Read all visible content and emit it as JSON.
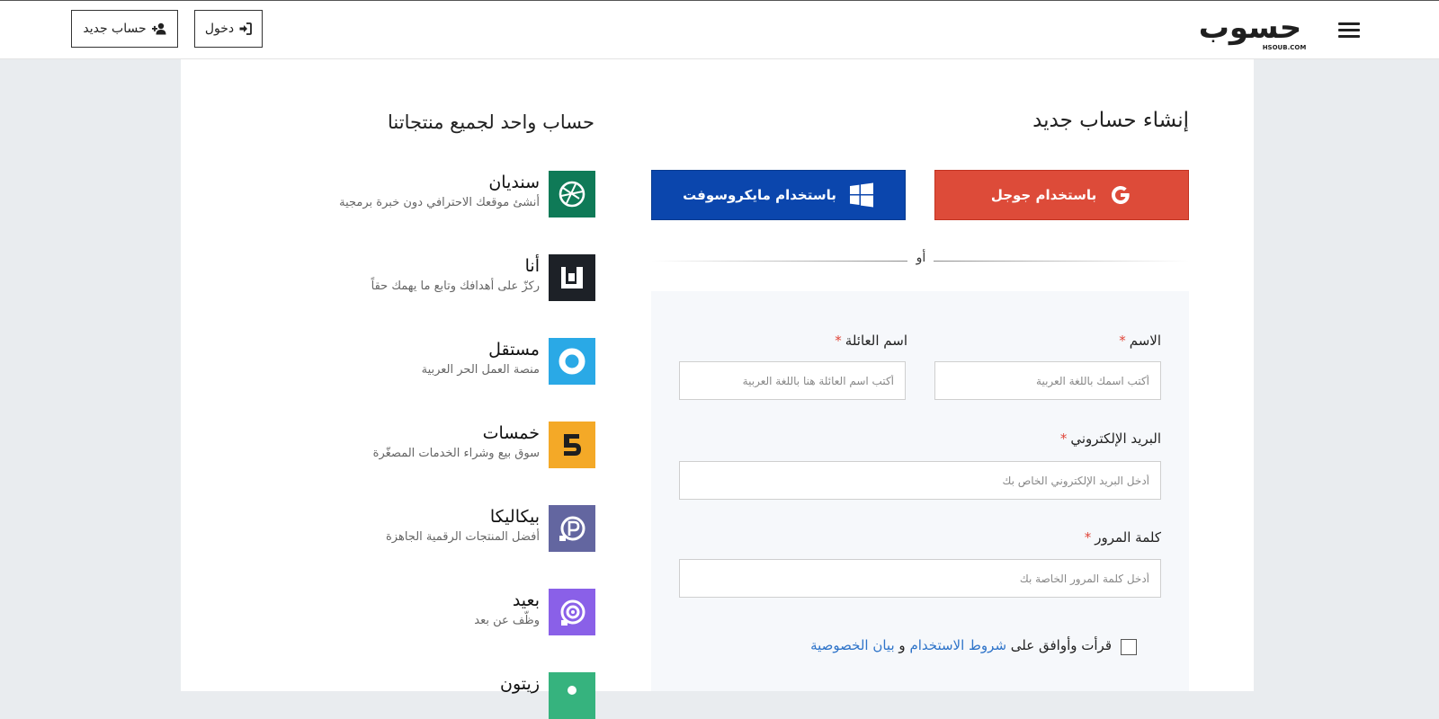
{
  "header": {
    "logo_text": "حسوب",
    "logo_sub": "HSOUB.COM",
    "login_label": "دخول",
    "register_label": "حساب جديد"
  },
  "signup": {
    "title": "إنشاء حساب جديد",
    "google_label": "باستخدام جوجل",
    "microsoft_label": "باستخدام مايكروسوفت",
    "divider": "أو",
    "first_name": {
      "label": "الاسم",
      "required": "*",
      "placeholder": "أكتب اسمك باللغة العربية"
    },
    "last_name": {
      "label": "اسم العائلة",
      "required": "*",
      "placeholder": "أكتب اسم العائلة هنا باللغة العربية"
    },
    "email": {
      "label": "البريد الإلكتروني",
      "required": "*",
      "placeholder": "أدخل البريد الإلكتروني الخاص بك"
    },
    "password": {
      "label": "كلمة المرور",
      "required": "*",
      "placeholder": "أدخل كلمة المرور الخاصة بك"
    },
    "agree": {
      "prefix": "قرأت وأوافق على",
      "terms": "شروط الاستخدام",
      "and": "و",
      "privacy": "بيان الخصوصية"
    }
  },
  "products_section": {
    "title": "حساب واحد لجميع منتجاتنا",
    "items": [
      {
        "name": "سنديان",
        "desc": "أنشئ موقعك الاحترافي دون خبرة برمجية",
        "icon": "sendian-icon",
        "color": "#0f7a57"
      },
      {
        "name": "أنا",
        "desc": "ركزّ على أهدافك وتابع ما يهمك حقاً",
        "icon": "ana-icon",
        "color": "#1d2127"
      },
      {
        "name": "مستقل",
        "desc": "منصة العمل الحر العربية",
        "icon": "mostaql-icon",
        "color": "#2aa9e6"
      },
      {
        "name": "خمسات",
        "desc": "سوق بيع وشراء الخدمات المصغّرة",
        "icon": "khamsat-icon",
        "color": "#f4a927"
      },
      {
        "name": "بيكاليكا",
        "desc": "أفضل المنتجات الرقمية الجاهزة",
        "icon": "picalica-icon",
        "color": "#6366a0"
      },
      {
        "name": "بعيد",
        "desc": "وظّف عن بعد",
        "icon": "baeed-icon",
        "color": "#8a60e8"
      },
      {
        "name": "زيتون",
        "desc": "",
        "icon": "zyton-icon",
        "color": "#36b37e"
      }
    ]
  },
  "colors": {
    "google": "#dd4b39",
    "microsoft": "#0b46ad",
    "required": "#e0463a",
    "link": "#2f74c9",
    "page_bg": "#e9ecef",
    "form_bg": "#f6f8fb"
  }
}
